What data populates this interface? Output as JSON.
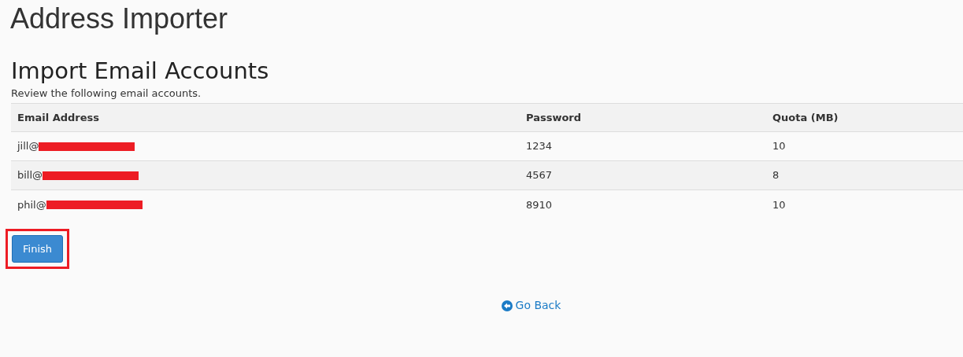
{
  "page_title": "Address Importer",
  "section": {
    "title": "Import Email Accounts",
    "description": "Review the following email accounts."
  },
  "table": {
    "columns": [
      "Email Address",
      "Password",
      "Quota (MB)"
    ],
    "rows": [
      {
        "email": "jill@",
        "redacted": true,
        "password": "1234",
        "quota": "10"
      },
      {
        "email": "bill@",
        "redacted": true,
        "password": "4567",
        "quota": "8"
      },
      {
        "email": "phil@",
        "redacted": true,
        "password": "8910",
        "quota": "10"
      }
    ]
  },
  "finish_button": {
    "label": "Finish",
    "highlighted": true
  },
  "back_link": {
    "label": "Go Back"
  }
}
